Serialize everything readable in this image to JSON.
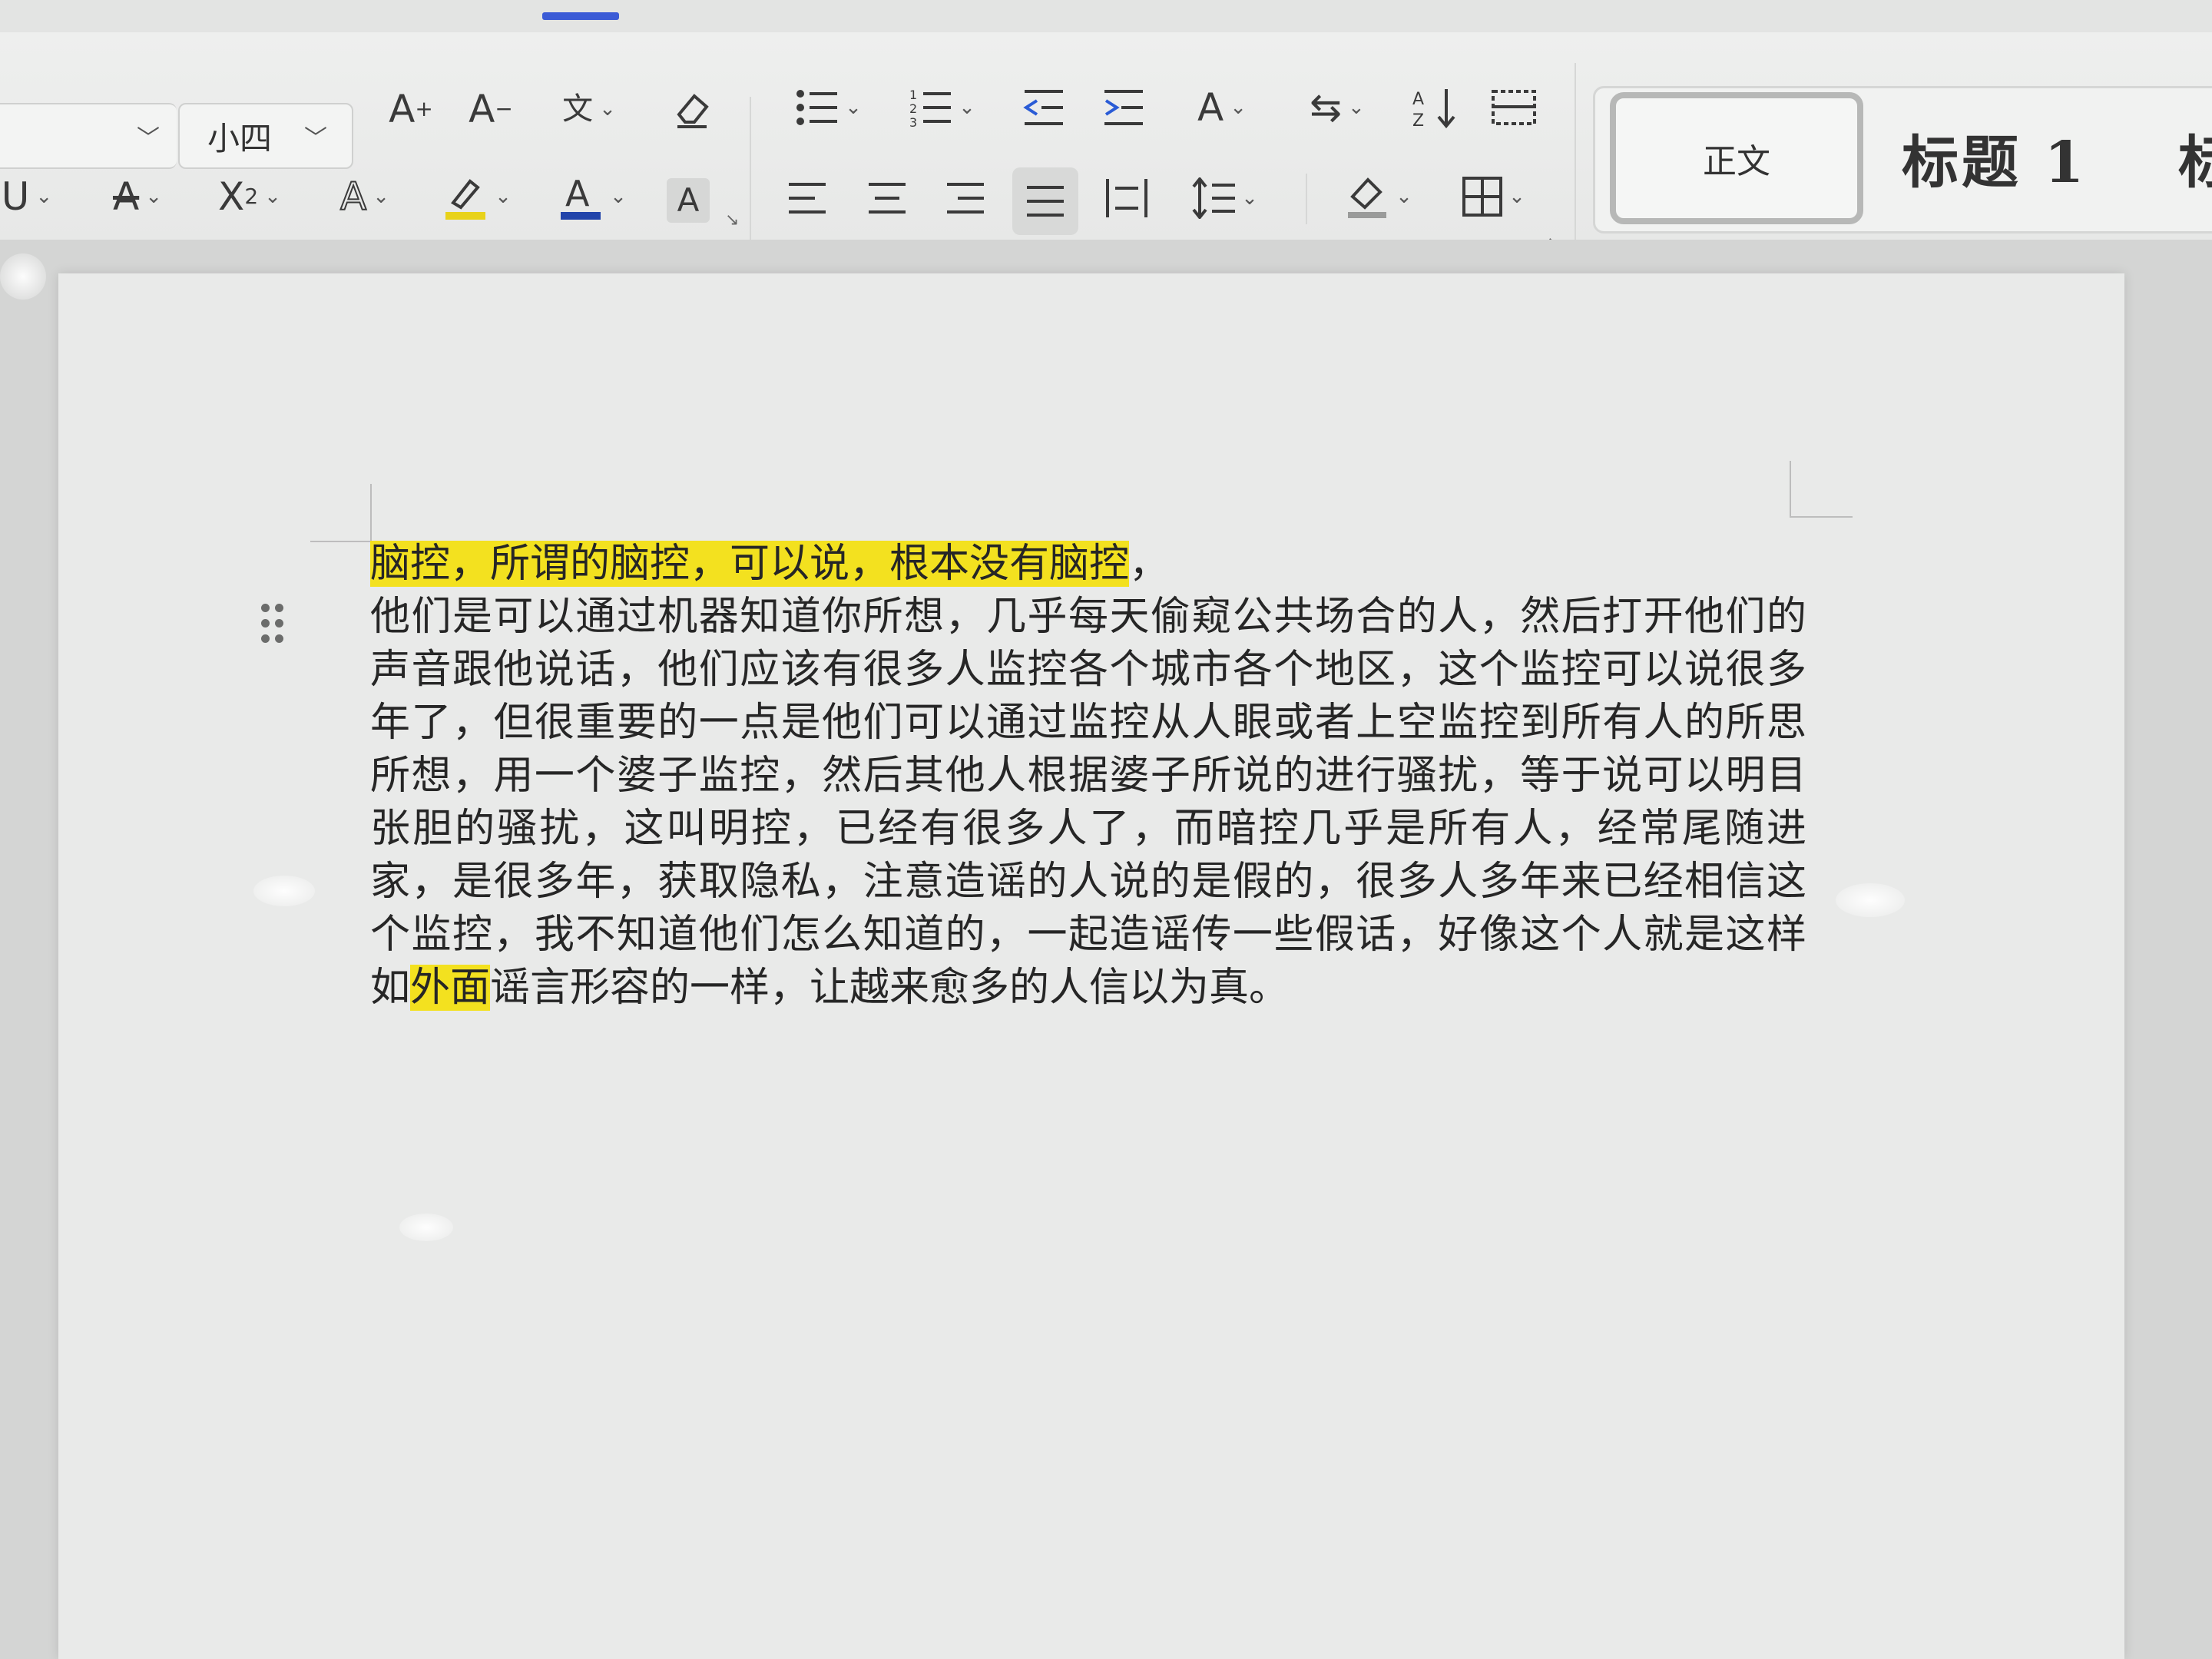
{
  "ribbon": {
    "font_size": "小四",
    "styles": {
      "normal": "正文",
      "heading1": "标题 1",
      "heading2_partial": "标"
    },
    "tools_row1": [
      {
        "name": "grow-font-icon",
        "glyph": "A⁺"
      },
      {
        "name": "shrink-font-icon",
        "glyph": "A⁻"
      },
      {
        "name": "phonetic-guide-icon",
        "glyph": "wén"
      },
      {
        "name": "clear-format-icon",
        "glyph": "eraser"
      },
      {
        "name": "bullets-icon",
        "glyph": "bullets"
      },
      {
        "name": "numbering-icon",
        "glyph": "numbering"
      },
      {
        "name": "decrease-indent-icon",
        "glyph": "outdent"
      },
      {
        "name": "increase-indent-icon",
        "glyph": "indent"
      },
      {
        "name": "text-direction-icon",
        "glyph": "A"
      },
      {
        "name": "ltr-rtl-icon",
        "glyph": "swap"
      },
      {
        "name": "sort-icon",
        "glyph": "sort"
      },
      {
        "name": "table-borders-icon",
        "glyph": "grid"
      }
    ]
  },
  "document": {
    "highlight_color": "#f3e11f",
    "line1_highlighted": "脑控，所谓的脑控，可以说，根本没有脑控",
    "line1_tail": "，",
    "para_main": "他们是可以通过机器知道你所想，几乎每天偷窥公共场合的人，然后打开他们的声音跟他说话，他们应该有很多人监控各个城市各个地区，这个监控可以说很多年了，但很重要的一点是他们可以通过监控从人眼或者上空监控到所有人的所思所想，用一个婆子监控，然后其他人根据婆子所说的进行骚扰，等于说可以明目张胆的骚扰，这叫明控，已经有很多人了，而暗控几乎是所有人，经常尾随进家，是很多年，获取隐私，注意造谣的人说的是假的，很多人多年来已经相信这个监控，我不知道他们怎么知道的，一起造谣传一些假话，好像这个人就是这样如",
    "para_highlighted": "外面",
    "para_tail": "谣言形容的一样，让越来愈多的人信以为真。"
  }
}
